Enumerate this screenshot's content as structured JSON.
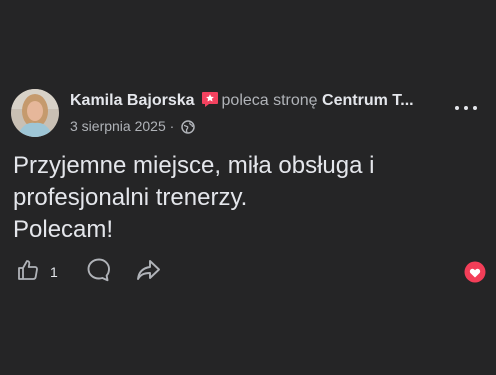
{
  "post": {
    "author": "Kamila Bajorska",
    "action_text": "poleca stronę",
    "page_name": "Centrum T...",
    "date": "3 sierpnia 2025",
    "separator": "·",
    "body": "Przyjemne miejsce, miła obsługa i\nprofesjonalni trenerzy.\nPolecam!",
    "like_count": "1"
  },
  "icons": {
    "recommend": "recommend-badge-icon",
    "privacy": "globe-icon",
    "menu": "more-options-icon",
    "like": "thumbs-up-icon",
    "comment": "comment-icon",
    "share": "share-icon",
    "reaction": "love-reaction-icon"
  },
  "colors": {
    "background": "#252526",
    "text": "#e4e6eb",
    "secondary": "#b0b3b8",
    "recommend_badge": "#f3425f",
    "love": "#f33e58"
  }
}
